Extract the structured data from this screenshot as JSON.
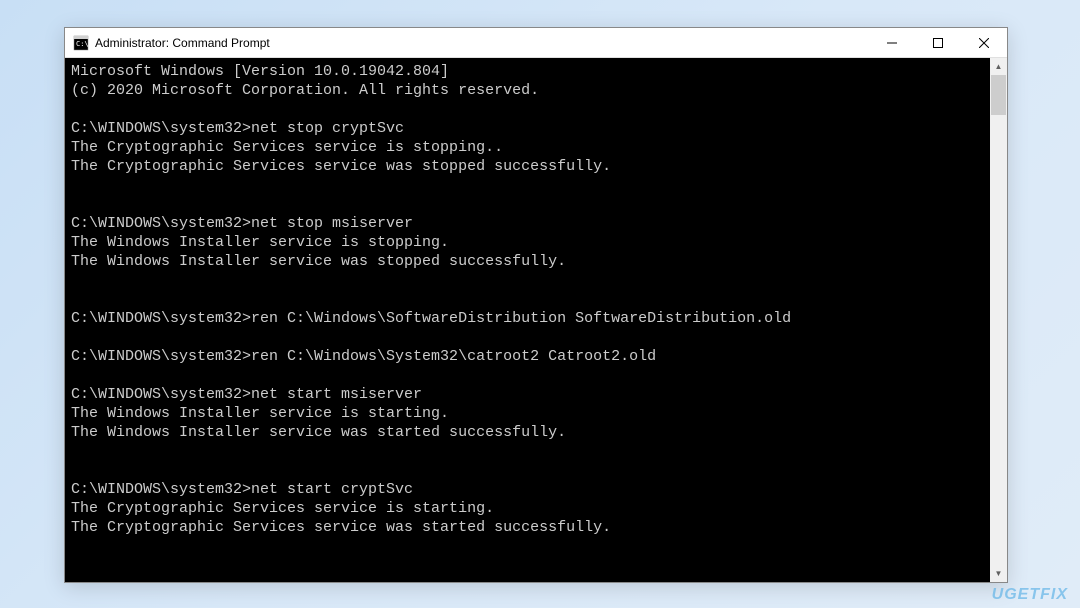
{
  "window": {
    "title": "Administrator: Command Prompt"
  },
  "terminal": {
    "lines": [
      "Microsoft Windows [Version 10.0.19042.804]",
      "(c) 2020 Microsoft Corporation. All rights reserved.",
      "",
      "C:\\WINDOWS\\system32>net stop cryptSvc",
      "The Cryptographic Services service is stopping..",
      "The Cryptographic Services service was stopped successfully.",
      "",
      "",
      "C:\\WINDOWS\\system32>net stop msiserver",
      "The Windows Installer service is stopping.",
      "The Windows Installer service was stopped successfully.",
      "",
      "",
      "C:\\WINDOWS\\system32>ren C:\\Windows\\SoftwareDistribution SoftwareDistribution.old",
      "",
      "C:\\WINDOWS\\system32>ren C:\\Windows\\System32\\catroot2 Catroot2.old",
      "",
      "C:\\WINDOWS\\system32>net start msiserver",
      "The Windows Installer service is starting.",
      "The Windows Installer service was started successfully.",
      "",
      "",
      "C:\\WINDOWS\\system32>net start cryptSvc",
      "The Cryptographic Services service is starting.",
      "The Cryptographic Services service was started successfully.",
      "",
      ""
    ]
  },
  "watermark": "UGETFIX"
}
